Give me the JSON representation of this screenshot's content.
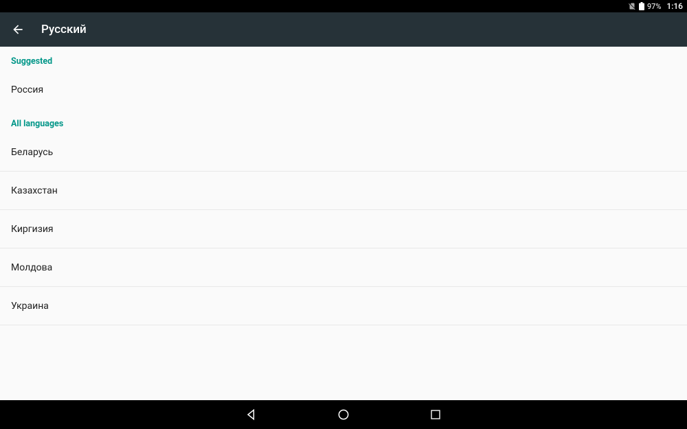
{
  "status": {
    "battery_pct": "97%",
    "clock": "1:16"
  },
  "header": {
    "title": "Русский"
  },
  "sections": {
    "suggested_label": "Suggested",
    "all_label": "All languages"
  },
  "suggested": [
    {
      "label": "Россия"
    }
  ],
  "all": [
    {
      "label": "Беларусь"
    },
    {
      "label": "Казахстан"
    },
    {
      "label": "Киргизия"
    },
    {
      "label": "Молдова"
    },
    {
      "label": "Украина"
    }
  ]
}
